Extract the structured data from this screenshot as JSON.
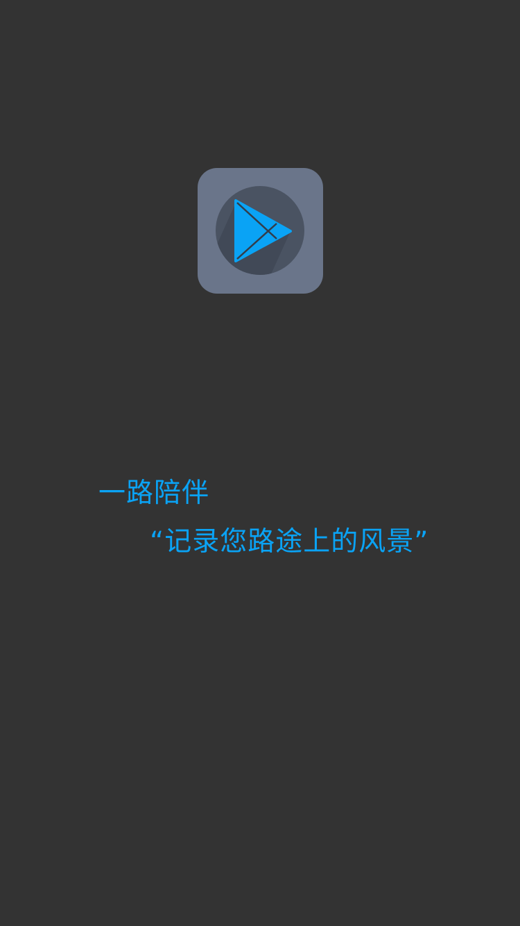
{
  "splash": {
    "app_icon": "play-icon",
    "tagline": "一路陪伴",
    "quote": "“记录您路途上的风景”"
  },
  "colors": {
    "background": "#333333",
    "icon_tile": "#6a758a",
    "icon_circle": "#4a5362",
    "accent": "#0aa3f5"
  }
}
